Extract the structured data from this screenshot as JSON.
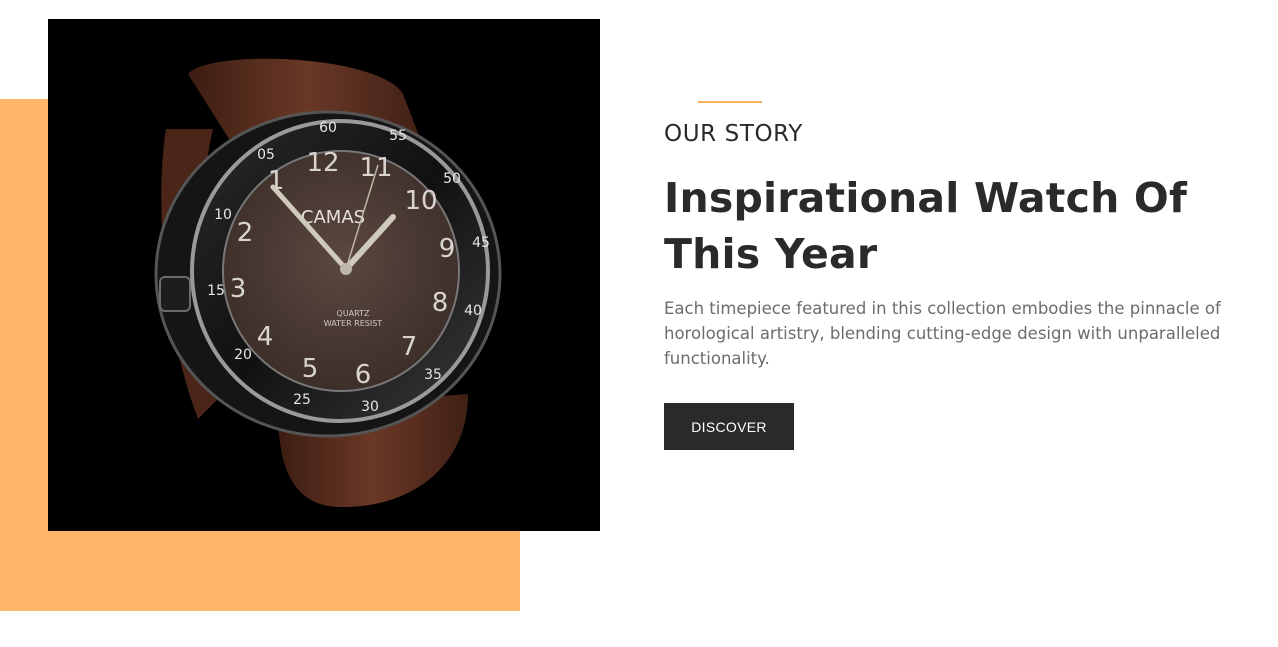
{
  "section": {
    "eyebrow": "OUR STORY",
    "headline": "Inspirational Watch Of This Year",
    "body": "Each timepiece featured in this collection embodies the pinnacle of horological artistry, blending cutting-edge design with unparalleled functionality.",
    "cta_label": "DISCOVER"
  },
  "watch": {
    "dial_brand": "CAMAS",
    "dial_line1": "QUARTZ",
    "dial_line2": "WATER RESIST",
    "dial_numbers": [
      "12",
      "11",
      "10",
      "9",
      "8",
      "7",
      "6",
      "5",
      "4",
      "3",
      "2",
      "1"
    ],
    "bezel_numbers": [
      "60",
      "55",
      "50",
      "45",
      "40",
      "35",
      "30",
      "25",
      "20",
      "15",
      "10",
      "05"
    ]
  },
  "colors": {
    "accent_block": "#ffb66a",
    "accent_line": "#f6b25d",
    "text_dark": "#2b2a2b",
    "text_body": "#6f6b6b",
    "button_bg": "#2b2a2b",
    "strap": "#5a3020",
    "dial": "#4b3a33"
  },
  "icons": {
    "product_image": "watch-image"
  }
}
